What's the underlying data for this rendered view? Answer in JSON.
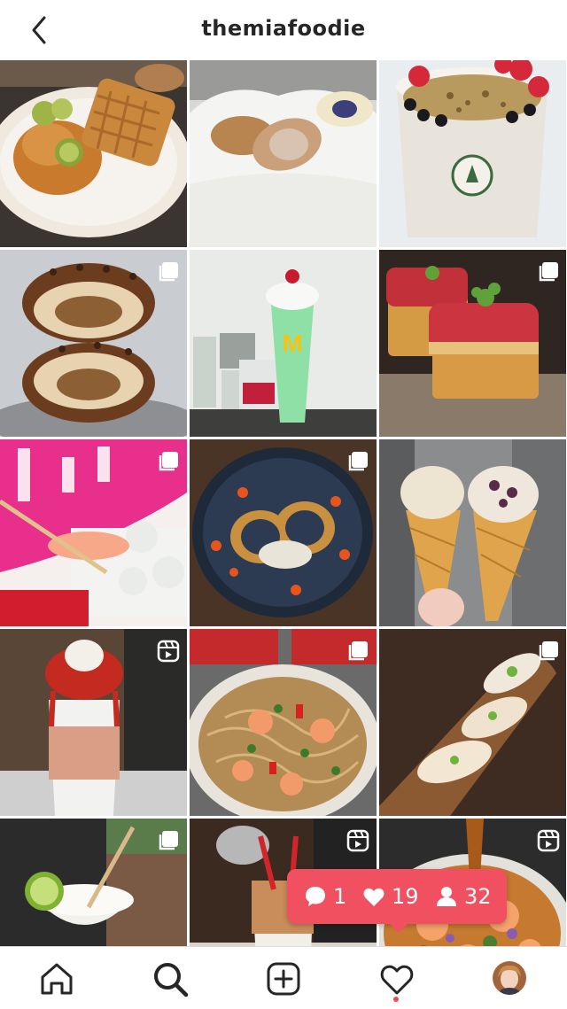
{
  "header": {
    "title": "themiafoodie",
    "back_icon": "chevron-left-icon"
  },
  "grid": {
    "tiles": [
      {
        "name": "chicken-waffles",
        "badge": "none"
      },
      {
        "name": "bread-basket",
        "badge": "none"
      },
      {
        "name": "strawberry-cup",
        "badge": "none"
      },
      {
        "name": "stuffed-donut",
        "badge": "carousel"
      },
      {
        "name": "green-shake",
        "badge": "none"
      },
      {
        "name": "tuna-toast",
        "badge": "carousel"
      },
      {
        "name": "shrimp-sushi",
        "badge": "carousel"
      },
      {
        "name": "tostada-plate",
        "badge": "carousel"
      },
      {
        "name": "waffle-cones",
        "badge": "none"
      },
      {
        "name": "strawberry-shake",
        "badge": "reel"
      },
      {
        "name": "shrimp-noodles",
        "badge": "carousel"
      },
      {
        "name": "nigiri-board",
        "badge": "carousel"
      },
      {
        "name": "margarita",
        "badge": "carousel"
      },
      {
        "name": "chocolate-pour",
        "badge": "reel"
      },
      {
        "name": "seafood-bowl",
        "badge": "reel"
      }
    ]
  },
  "notification": {
    "comments": "1",
    "likes": "19",
    "follows": "32",
    "color": "#f0505f"
  },
  "bottom_nav": {
    "items": [
      "home-icon",
      "search-icon",
      "add-post-icon",
      "activity-heart-icon",
      "profile-avatar"
    ],
    "active": "search-icon",
    "dot_color": "#ed4956"
  }
}
